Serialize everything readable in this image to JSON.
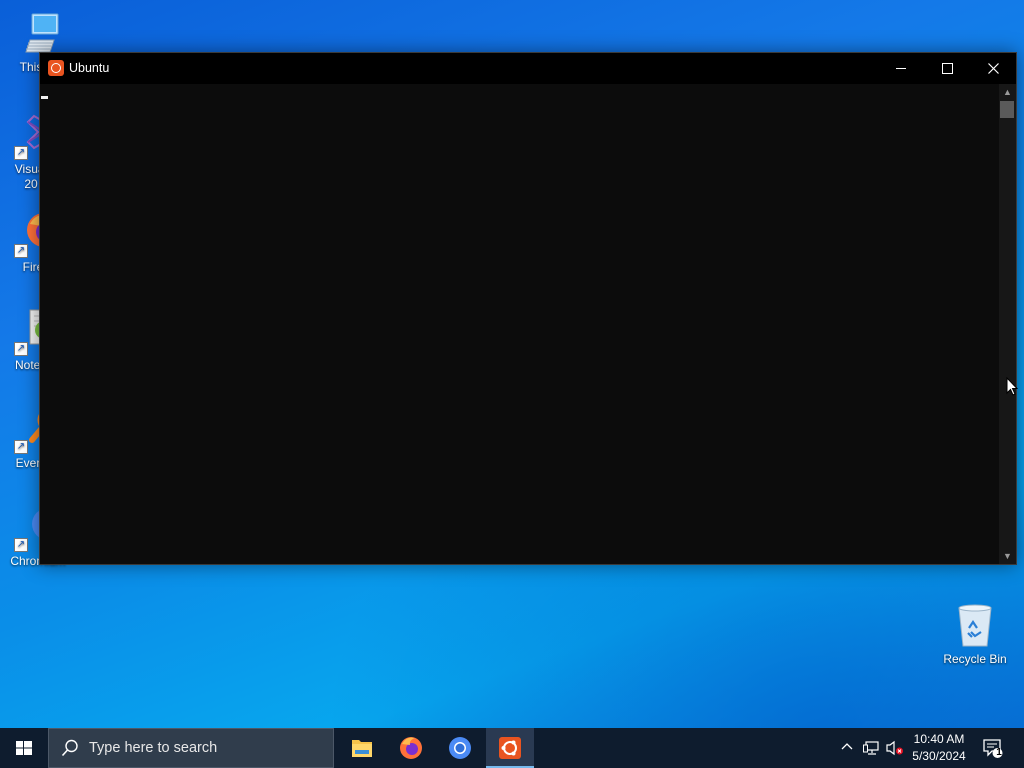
{
  "desktop": {
    "icons": [
      {
        "label": "This",
        "name": "this-pc"
      },
      {
        "label": "Visual",
        "label2": "20",
        "name": "visual-studio"
      },
      {
        "label": "Fire",
        "name": "firefox"
      },
      {
        "label": "Notep",
        "name": "notepad-plus-plus"
      },
      {
        "label": "Every",
        "name": "everything"
      },
      {
        "label": "Chromium",
        "name": "chromium"
      }
    ],
    "recycle_bin": {
      "label": "Recycle Bin",
      "icon": "recycle-bin-icon"
    }
  },
  "window": {
    "title": "Ubuntu",
    "app_icon": "ubuntu-icon",
    "controls": {
      "minimize": "minimize-icon",
      "maximize": "maximize-icon",
      "close": "close-icon"
    },
    "background": "#0c0c0c"
  },
  "taskbar": {
    "search_placeholder": "Type here to search",
    "apps": [
      {
        "name": "file-explorer",
        "icon": "folder-icon",
        "active": false
      },
      {
        "name": "firefox",
        "icon": "firefox-icon",
        "active": false
      },
      {
        "name": "chromium",
        "icon": "chromium-icon",
        "active": false
      },
      {
        "name": "ubuntu",
        "icon": "ubuntu-icon",
        "active": true
      }
    ],
    "clock": {
      "time": "10:40 AM",
      "date": "5/30/2024"
    },
    "notifications_count": "1",
    "tray_icons": [
      "chevron-up-icon",
      "network-icon",
      "volume-muted-icon"
    ]
  },
  "colors": {
    "accent": "#e95420",
    "taskbar": "#0e1c2e",
    "active_indicator": "#76b9ed"
  }
}
